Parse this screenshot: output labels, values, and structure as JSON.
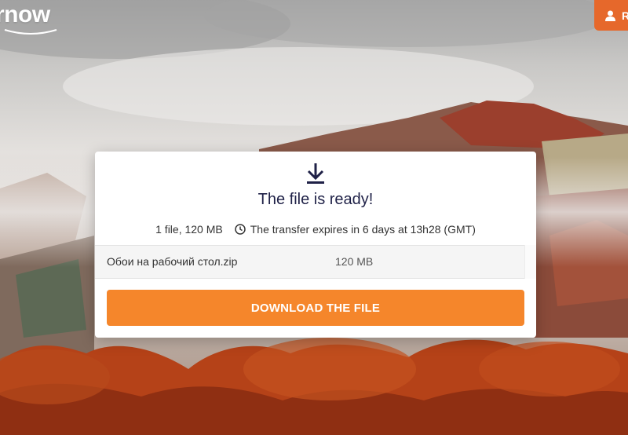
{
  "header": {
    "logo_text": "rnow",
    "account_button_label": "R",
    "icons": [
      "user-icon"
    ]
  },
  "card": {
    "icon": "download-icon",
    "title": "The file is ready!",
    "file_count_size": "1 file, 120 MB",
    "expiry_text": "The transfer expires in 6 days at 13h28 (GMT)",
    "expiry_icon": "clock-icon",
    "files": [
      {
        "name": "Обои на рабочий стол.zip",
        "size": "120 MB"
      }
    ],
    "download_button_label": "DOWNLOAD THE FILE"
  },
  "colors": {
    "accent": "#f5862b",
    "header_button": "#e6682b",
    "title": "#1f2147"
  }
}
